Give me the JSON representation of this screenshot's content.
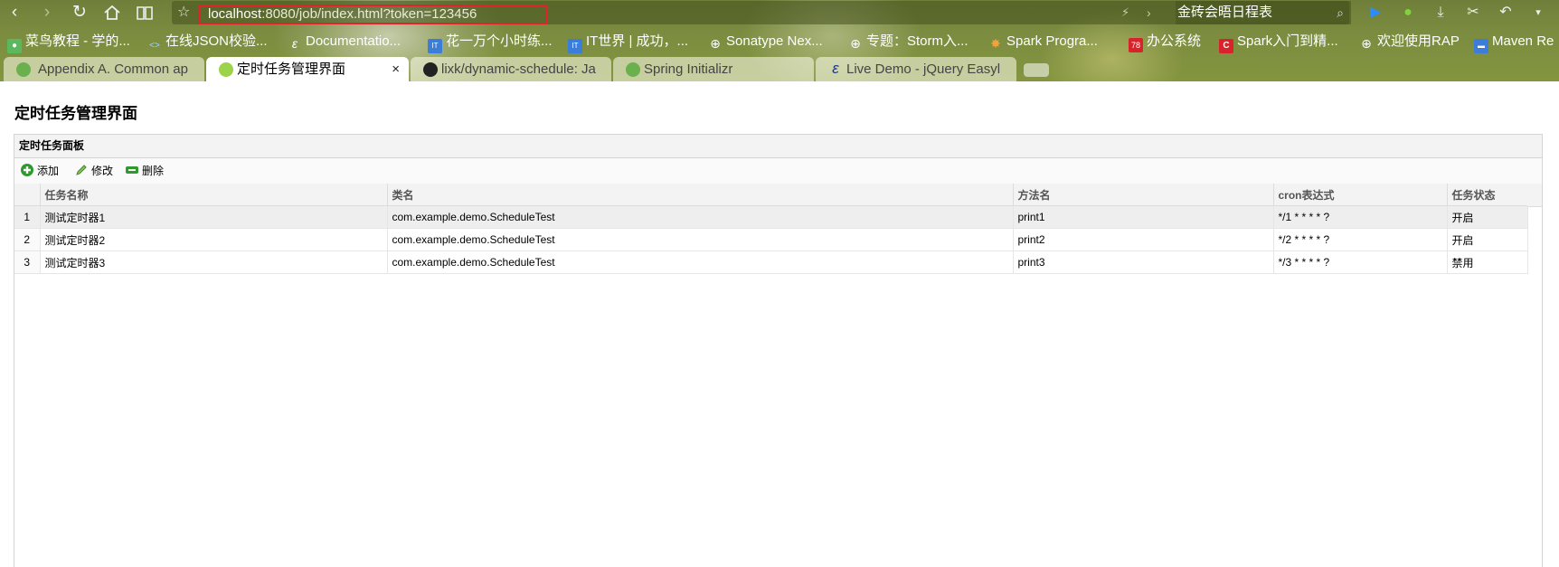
{
  "browser": {
    "url_host": "localhost",
    "url_rest": ":8080/job/index.html?token=123456",
    "search_text": "金砖会晤日程表",
    "icons": {
      "back": "chevron-left-icon",
      "forward": "chevron-right-icon",
      "reload": "reload-icon",
      "home": "home-icon",
      "reader": "book-icon",
      "bookmark": "star-icon"
    }
  },
  "bookmarks": [
    {
      "label": "菜鸟教程 - 学的..."
    },
    {
      "label": "在线JSON校验..."
    },
    {
      "label": "Documentatio..."
    },
    {
      "label": "花一万个小时练..."
    },
    {
      "label": "IT世界 | 成功，..."
    },
    {
      "label": "Sonatype Nex..."
    },
    {
      "label": "专题：Storm入..."
    },
    {
      "label": "Spark Progra..."
    },
    {
      "label": "办公系统"
    },
    {
      "label": "Spark入门到精..."
    },
    {
      "label": "欢迎使用RAP"
    },
    {
      "label": "Maven Re"
    }
  ],
  "tabs": [
    {
      "title": "Appendix A. Common ap",
      "active": false
    },
    {
      "title": "定时任务管理界面",
      "active": true,
      "close": "×"
    },
    {
      "title": "lixk/dynamic-schedule: Ja",
      "active": false
    },
    {
      "title": "Spring Initializr",
      "active": false
    },
    {
      "title": "Live Demo - jQuery Easyl",
      "active": false
    }
  ],
  "page": {
    "title": "定时任务管理界面",
    "panel_title": "定时任务面板",
    "toolbar": {
      "add": "添加",
      "edit": "修改",
      "delete": "删除"
    }
  },
  "table": {
    "columns": [
      "任务名称",
      "类名",
      "方法名",
      "cron表达式",
      "任务状态"
    ],
    "rows": [
      {
        "num": "1",
        "name": "测试定时器1",
        "class": "com.example.demo.ScheduleTest",
        "method": "print1",
        "cron": "*/1 * * * * ?",
        "status": "开启"
      },
      {
        "num": "2",
        "name": "测试定时器2",
        "class": "com.example.demo.ScheduleTest",
        "method": "print2",
        "cron": "*/2 * * * * ?",
        "status": "开启"
      },
      {
        "num": "3",
        "name": "测试定时器3",
        "class": "com.example.demo.ScheduleTest",
        "method": "print3",
        "cron": "*/3 * * * * ?",
        "status": "禁用"
      }
    ]
  },
  "colors": {
    "url_highlight": "#e2232a",
    "add_icon": "#2e9a2e",
    "edit_icon": "#3a8a2a",
    "delete_icon": "#2e9a2e"
  }
}
